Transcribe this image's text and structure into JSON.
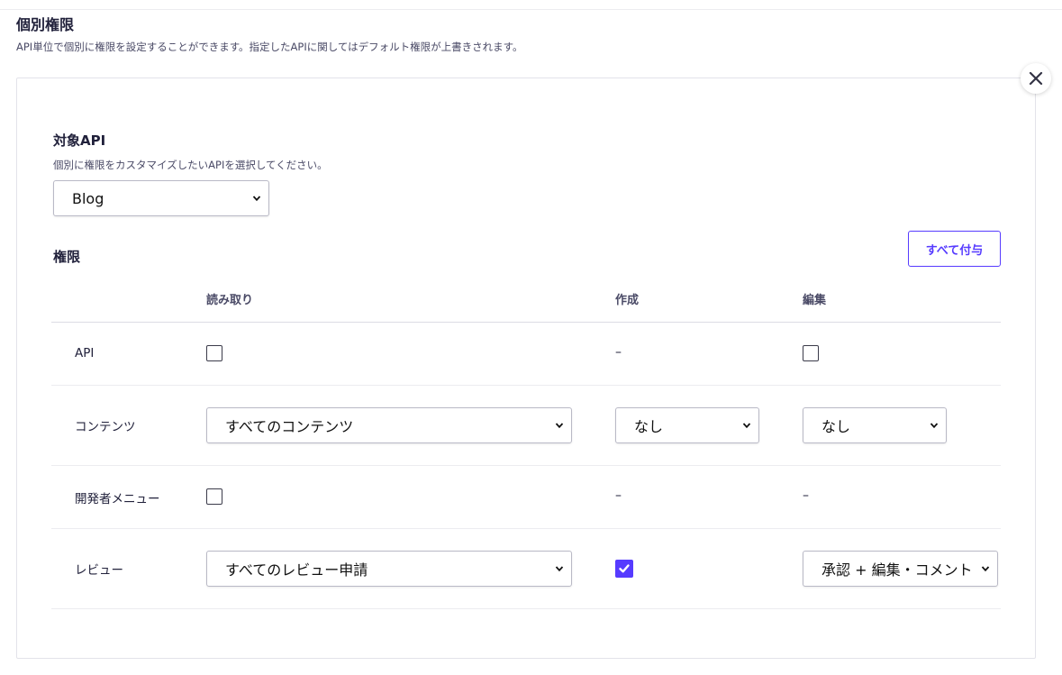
{
  "section": {
    "title": "個別権限",
    "description": "API単位で個別に権限を設定することができます。指定したAPIに関してはデフォルト権限が上書きされます。"
  },
  "close_icon": "close-icon",
  "target_api": {
    "label": "対象API",
    "hint": "個別に権限をカスタマイズしたいAPIを選択してください。",
    "selected": "Blog"
  },
  "permissions": {
    "label": "権限",
    "grant_all_label": "すべて付与",
    "columns": [
      "読み取り",
      "作成",
      "編集"
    ],
    "rows": [
      {
        "label": "API",
        "read": {
          "type": "checkbox",
          "checked": false
        },
        "create": {
          "type": "dash",
          "text": "–"
        },
        "edit": {
          "type": "checkbox",
          "checked": false
        }
      },
      {
        "label": "コンテンツ",
        "read": {
          "type": "select",
          "value": "すべてのコンテンツ"
        },
        "create": {
          "type": "select",
          "value": "なし"
        },
        "edit": {
          "type": "select",
          "value": "なし"
        }
      },
      {
        "label": "開発者メニュー",
        "read": {
          "type": "checkbox",
          "checked": false
        },
        "create": {
          "type": "dash",
          "text": "–"
        },
        "edit": {
          "type": "dash",
          "text": "–"
        }
      },
      {
        "label": "レビュー",
        "read": {
          "type": "select",
          "value": "すべてのレビュー申請"
        },
        "create": {
          "type": "checkbox",
          "checked": true
        },
        "edit": {
          "type": "select",
          "value": "承認 + 編集・コメント"
        }
      }
    ]
  },
  "colors": {
    "accent": "#563bff",
    "text": "#21213b",
    "muted": "#4a4a66",
    "border": "#e3e3ea"
  }
}
